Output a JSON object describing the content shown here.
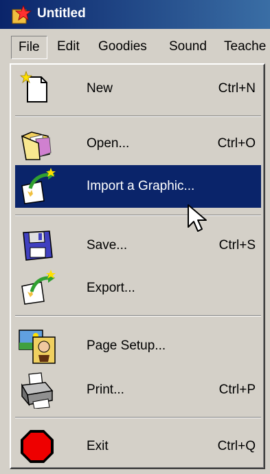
{
  "window": {
    "title": "Untitled"
  },
  "menubar": {
    "items": [
      {
        "label": "File"
      },
      {
        "label": "Edit"
      },
      {
        "label": "Goodies"
      },
      {
        "label": "Sound"
      },
      {
        "label": "Teache"
      }
    ]
  },
  "file_menu": {
    "items": [
      {
        "label": "New",
        "shortcut": "Ctrl+N",
        "icon": "new-page-icon"
      },
      {
        "label": "Open...",
        "shortcut": "Ctrl+O",
        "icon": "open-folder-icon"
      },
      {
        "label": "Import a Graphic...",
        "shortcut": "",
        "icon": "import-graphic-icon"
      },
      {
        "label": "Save...",
        "shortcut": "Ctrl+S",
        "icon": "floppy-disk-icon"
      },
      {
        "label": "Export...",
        "shortcut": "",
        "icon": "export-icon"
      },
      {
        "label": "Page Setup...",
        "shortcut": "",
        "icon": "page-setup-icon"
      },
      {
        "label": "Print...",
        "shortcut": "Ctrl+P",
        "icon": "printer-icon"
      },
      {
        "label": "Exit",
        "shortcut": "Ctrl+Q",
        "icon": "stop-sign-icon"
      }
    ],
    "highlighted": "Import a Graphic..."
  },
  "colors": {
    "title_bar": "#0a246a",
    "highlight": "#0a246a",
    "menu_bg": "#d4d0c8"
  }
}
